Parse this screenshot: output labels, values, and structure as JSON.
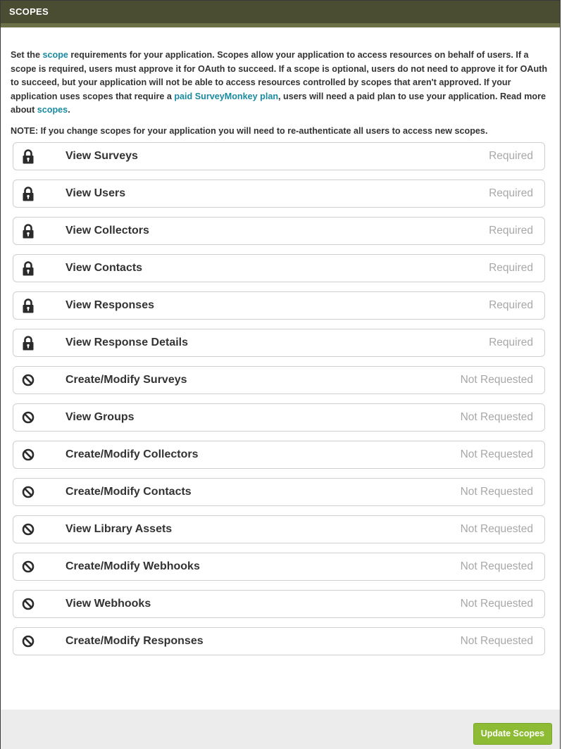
{
  "header": {
    "title": "SCOPES"
  },
  "intro": {
    "t1": "Set the ",
    "link_scope": "scope",
    "t2": " requirements for your application. Scopes allow your application to access resources on behalf of users. If a scope is required, users must approve it for OAuth to succeed. If a scope is optional, users do not need to approve it for OAuth to succeed, but your application will not be able to access resources controlled by scopes that aren't approved. If your application uses scopes that require a ",
    "link_plan": "paid SurveyMonkey plan",
    "t3": ", users will need a paid plan to use your application. Read more about ",
    "link_scopes": "scopes",
    "t4": "."
  },
  "note": "NOTE: If you change scopes for your application you will need to re-authenticate all users to access new scopes.",
  "scopes": [
    {
      "name": "View Surveys",
      "status": "Required",
      "icon": "lock-icon"
    },
    {
      "name": "View Users",
      "status": "Required",
      "icon": "lock-icon"
    },
    {
      "name": "View Collectors",
      "status": "Required",
      "icon": "lock-icon"
    },
    {
      "name": "View Contacts",
      "status": "Required",
      "icon": "lock-icon"
    },
    {
      "name": "View Responses",
      "status": "Required",
      "icon": "lock-icon"
    },
    {
      "name": "View Response Details",
      "status": "Required",
      "icon": "lock-icon"
    },
    {
      "name": "Create/Modify Surveys",
      "status": "Not Requested",
      "icon": "block-icon"
    },
    {
      "name": "View Groups",
      "status": "Not Requested",
      "icon": "block-icon"
    },
    {
      "name": "Create/Modify Collectors",
      "status": "Not Requested",
      "icon": "block-icon"
    },
    {
      "name": "Create/Modify Contacts",
      "status": "Not Requested",
      "icon": "block-icon"
    },
    {
      "name": "View Library Assets",
      "status": "Not Requested",
      "icon": "block-icon"
    },
    {
      "name": "Create/Modify Webhooks",
      "status": "Not Requested",
      "icon": "block-icon"
    },
    {
      "name": "View Webhooks",
      "status": "Not Requested",
      "icon": "block-icon"
    },
    {
      "name": "Create/Modify Responses",
      "status": "Not Requested",
      "icon": "block-icon"
    }
  ],
  "footer": {
    "update_label": "Update Scopes"
  },
  "colors": {
    "header_bg": "#4a4d31",
    "link": "#1a8aa0",
    "button": "#8dbb33",
    "status_text": "#a8a8a8"
  }
}
